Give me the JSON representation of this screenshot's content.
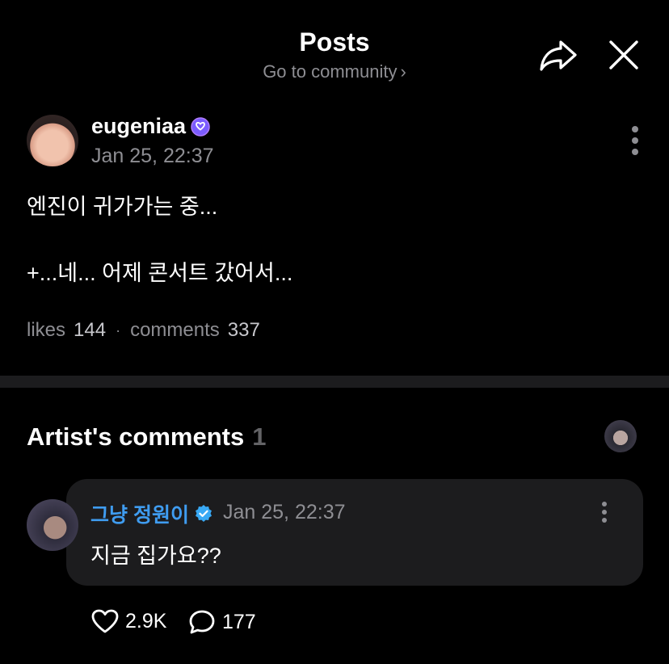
{
  "header": {
    "title": "Posts",
    "community_link": "Go to community",
    "chevron": "›"
  },
  "post": {
    "username": "eugeniaa",
    "timestamp": "Jan 25, 22:37",
    "body": "엔진이 귀가가는 중...\n\n+...네... 어제 콘서트 갔어서...",
    "likes_label": "likes",
    "likes_count": "144",
    "comments_label": "comments",
    "comments_count": "337",
    "separator": "·"
  },
  "artist_comments": {
    "title": "Artist's comments",
    "count": "1",
    "comment": {
      "username": "그냥 정원이",
      "timestamp": "Jan 25, 22:37",
      "text": "지금 집가요??",
      "likes": "2.9K",
      "replies": "177"
    }
  },
  "colors": {
    "background": "#000000",
    "secondary_text": "#8e8e93",
    "artist_name": "#3f9cf0",
    "bubble": "#1c1c1e",
    "verified_purple": "#7b5cff",
    "verified_blue": "#38a9f5"
  },
  "icons": [
    "share-icon",
    "close-icon",
    "verified-purple-icon",
    "more-vertical-icon",
    "verified-blue-icon",
    "heart-icon",
    "comment-bubble-icon"
  ]
}
